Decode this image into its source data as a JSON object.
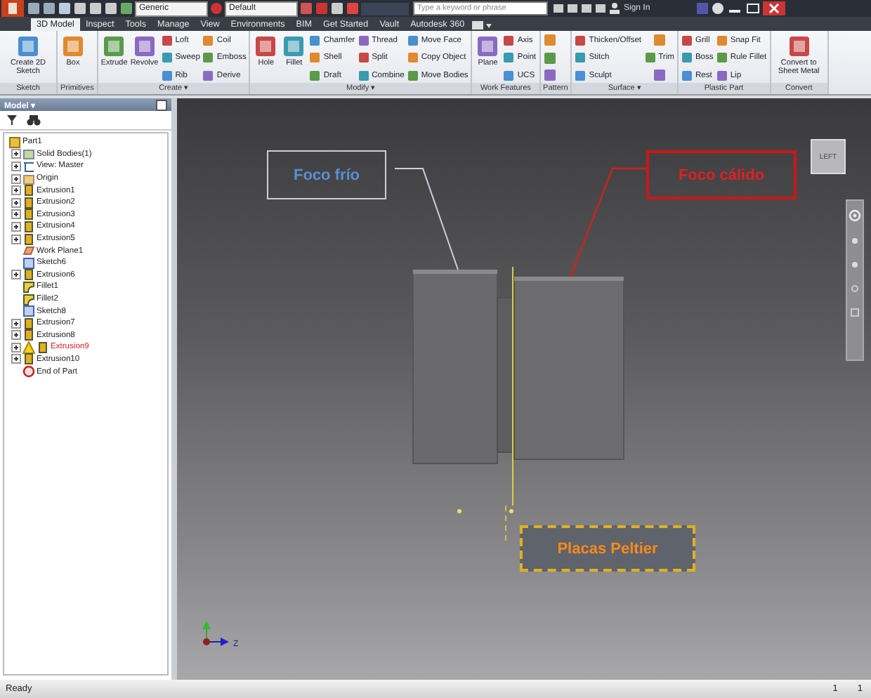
{
  "title_bar": {
    "style_dropdown": "Generic",
    "appearance_dropdown": "Default",
    "search": {
      "placeholder": "Type a keyword or phrase"
    },
    "sign_in": "Sign In"
  },
  "tabs": [
    {
      "label": "3D Model",
      "selected": true
    },
    {
      "label": "Inspect",
      "selected": false
    },
    {
      "label": "Tools",
      "selected": false
    },
    {
      "label": "Manage",
      "selected": false
    },
    {
      "label": "View",
      "selected": false
    },
    {
      "label": "Environments",
      "selected": false
    },
    {
      "label": "BIM",
      "selected": false
    },
    {
      "label": "Get Started",
      "selected": false
    },
    {
      "label": "Vault",
      "selected": false
    },
    {
      "label": "Autodesk 360",
      "selected": false
    }
  ],
  "ribbon": [
    {
      "label": "Sketch",
      "columns": [
        [
          {
            "label": "Create 2D Sketch",
            "kind": "large"
          }
        ]
      ]
    },
    {
      "label": "Primitives",
      "columns": [
        [
          {
            "label": "Box",
            "kind": "large"
          }
        ]
      ]
    },
    {
      "label": "Create ▾",
      "columns": [
        [
          {
            "label": "Extrude",
            "kind": "large"
          }
        ],
        [
          {
            "label": "Revolve",
            "kind": "large"
          }
        ],
        [
          {
            "label": "Loft",
            "kind": "small"
          },
          {
            "label": "Sweep",
            "kind": "small"
          },
          {
            "label": "Rib",
            "kind": "small"
          }
        ],
        [
          {
            "label": "Coil",
            "kind": "small"
          },
          {
            "label": "Emboss",
            "kind": "small"
          },
          {
            "label": "Derive",
            "kind": "small"
          }
        ]
      ]
    },
    {
      "label": "Modify ▾",
      "columns": [
        [
          {
            "label": "Hole",
            "kind": "large"
          }
        ],
        [
          {
            "label": "Fillet",
            "kind": "large"
          }
        ],
        [
          {
            "label": "Chamfer",
            "kind": "small"
          },
          {
            "label": "Shell",
            "kind": "small"
          },
          {
            "label": "Draft",
            "kind": "small"
          }
        ],
        [
          {
            "label": "Thread",
            "kind": "small"
          },
          {
            "label": "Split",
            "kind": "small"
          },
          {
            "label": "Combine",
            "kind": "small"
          }
        ],
        [
          {
            "label": "Move Face",
            "kind": "small"
          },
          {
            "label": "Copy Object",
            "kind": "small"
          },
          {
            "label": "Move Bodies",
            "kind": "small"
          }
        ]
      ]
    },
    {
      "label": "Work Features",
      "columns": [
        [
          {
            "label": "Plane",
            "kind": "large"
          }
        ],
        [
          {
            "label": "Axis",
            "kind": "small"
          },
          {
            "label": "Point",
            "kind": "small"
          },
          {
            "label": "UCS",
            "kind": "small"
          }
        ]
      ]
    },
    {
      "label": "Pattern",
      "columns": [
        [
          {
            "kind": "icon"
          },
          {
            "kind": "icon"
          },
          {
            "kind": "icon"
          }
        ]
      ]
    },
    {
      "label": "Surface ▾",
      "columns": [
        [
          {
            "label": "Thicken/Offset",
            "kind": "small"
          },
          {
            "label": "Stitch",
            "kind": "small"
          },
          {
            "label": "Sculpt",
            "kind": "small"
          }
        ],
        [
          {
            "kind": "icon"
          },
          {
            "label": "Trim",
            "kind": "small"
          },
          {
            "kind": "icon"
          }
        ]
      ]
    },
    {
      "label": "Plastic Part",
      "columns": [
        [
          {
            "label": "Grill",
            "kind": "small"
          },
          {
            "label": "Boss",
            "kind": "small"
          },
          {
            "label": "Rest",
            "kind": "small"
          }
        ],
        [
          {
            "label": "Snap Fit",
            "kind": "small"
          },
          {
            "label": "Rule Fillet",
            "kind": "small"
          },
          {
            "label": "Lip",
            "kind": "small"
          }
        ]
      ]
    },
    {
      "label": "Convert",
      "columns": [
        [
          {
            "label": "Convert to Sheet Metal",
            "kind": "large"
          }
        ]
      ]
    }
  ],
  "browser": {
    "title": "Model ▾",
    "tree": [
      {
        "label": "Part1",
        "kind": "part",
        "children": [
          {
            "label": "Solid Bodies(1)",
            "kind": "bodies",
            "has_children": true,
            "warning": false
          },
          {
            "label": "View: Master",
            "kind": "view",
            "has_children": true,
            "warning": false
          },
          {
            "label": "Origin",
            "kind": "origin",
            "has_children": true,
            "warning": false
          },
          {
            "label": "Extrusion1",
            "kind": "extrusion",
            "has_children": true,
            "warning": false
          },
          {
            "label": "Extrusion2",
            "kind": "extrusion",
            "has_children": true,
            "warning": false
          },
          {
            "label": "Extrusion3",
            "kind": "extrusion",
            "has_children": true,
            "warning": false
          },
          {
            "label": "Extrusion4",
            "kind": "extrusion",
            "has_children": true,
            "warning": false
          },
          {
            "label": "Extrusion5",
            "kind": "extrusion",
            "has_children": true,
            "warning": false
          },
          {
            "label": "Work Plane1",
            "kind": "workplane",
            "has_children": false,
            "warning": false
          },
          {
            "label": "Sketch6",
            "kind": "sketch",
            "has_children": false,
            "warning": false
          },
          {
            "label": "Extrusion6",
            "kind": "extrusion",
            "has_children": true,
            "warning": false
          },
          {
            "label": "Fillet1",
            "kind": "fillet",
            "has_children": false,
            "warning": false
          },
          {
            "label": "Fillet2",
            "kind": "fillet",
            "has_children": false,
            "warning": false
          },
          {
            "label": "Sketch8",
            "kind": "sketch",
            "has_children": false,
            "warning": false
          },
          {
            "label": "Extrusion7",
            "kind": "extrusion",
            "has_children": true,
            "warning": false
          },
          {
            "label": "Extrusion8",
            "kind": "extrusion",
            "has_children": true,
            "warning": false
          },
          {
            "label": "Extrusion9",
            "kind": "extrusion",
            "has_children": true,
            "warning": true
          },
          {
            "label": "Extrusion10",
            "kind": "extrusion",
            "has_children": true,
            "warning": false
          },
          {
            "label": "End of Part",
            "kind": "end",
            "has_children": false,
            "warning": false
          }
        ]
      }
    ]
  },
  "viewport": {
    "view_cube": "LEFT",
    "callouts": [
      {
        "kind": "cold",
        "text": "Foco frío"
      },
      {
        "kind": "hot",
        "text": "Foco cálido"
      },
      {
        "kind": "peltier",
        "text": "Placas Peltier"
      }
    ],
    "triad_label": "Z"
  },
  "status_bar": {
    "message": "Ready",
    "counts": [
      "1",
      "1"
    ]
  }
}
